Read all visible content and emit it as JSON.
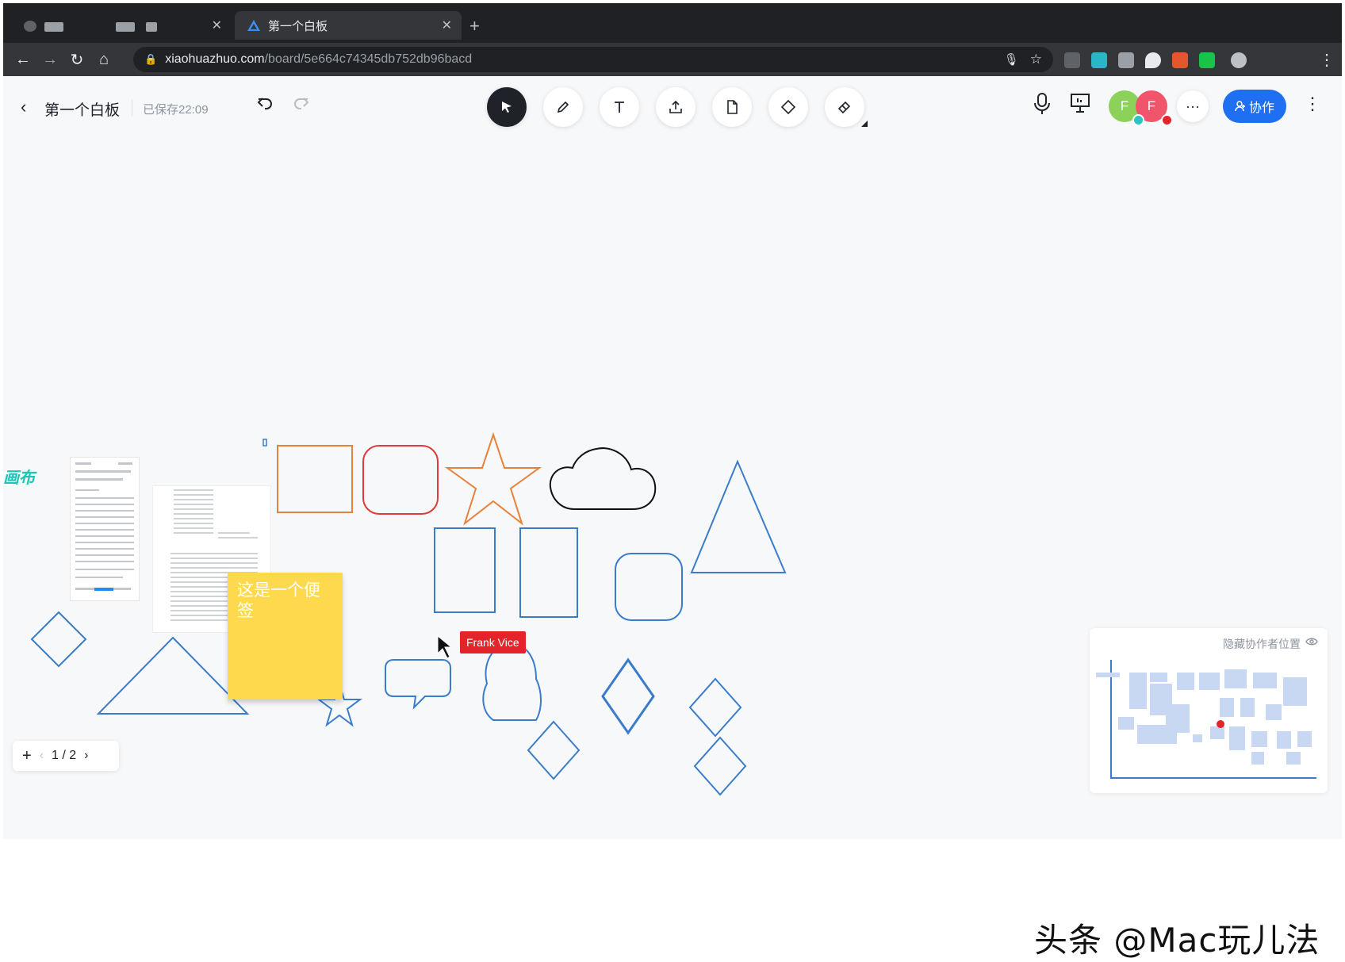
{
  "browser": {
    "active_tab_title": "第一个白板",
    "url_host": "xiaohuazhuo.com",
    "url_path": "/board/5e664c74345db752db96bacd"
  },
  "board": {
    "title": "第一个白板",
    "saved_status": "已保存22:09",
    "collab_label": "协作",
    "avatars": [
      {
        "letter": "F",
        "color": "#8bd15a"
      },
      {
        "letter": "F",
        "color": "#f0556b"
      }
    ],
    "tools": [
      "select-icon",
      "pen-icon",
      "text-icon",
      "upload-icon",
      "file-icon",
      "shape-icon",
      "eraser-icon"
    ]
  },
  "canvas": {
    "sticky_note_text": "这是一个便签",
    "cursor_label": "Frank Vice",
    "left_edge_text": "画布"
  },
  "minimap": {
    "label": "隐藏协作者位置"
  },
  "page_nav": {
    "label": "1 / 2"
  },
  "watermark": "头条 @Mac玩儿法",
  "colors": {
    "accent": "#1f6ff2",
    "shape_blue": "#3a7cc9",
    "shape_orange": "#e8813a",
    "shape_red": "#e03b3b",
    "sticky": "#ffd94d"
  }
}
